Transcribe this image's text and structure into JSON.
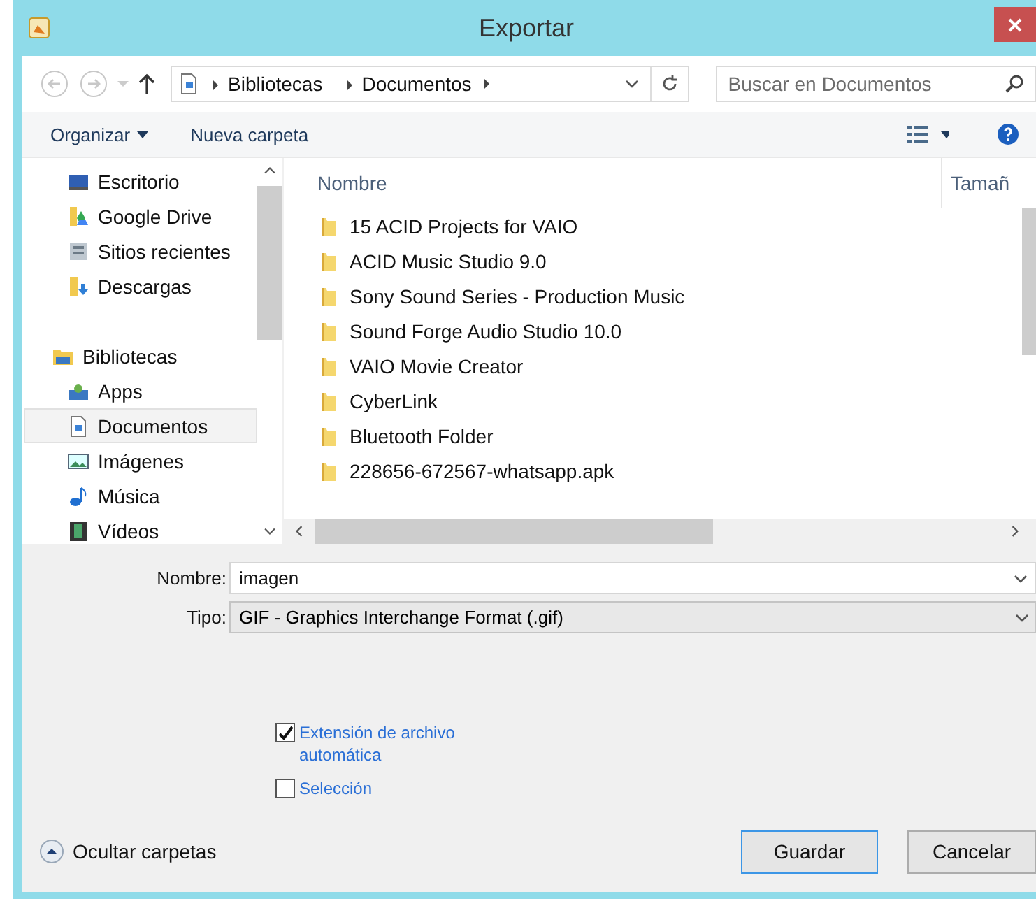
{
  "window": {
    "title": "Exportar"
  },
  "address": {
    "crumbs": [
      "Bibliotecas",
      "Documentos"
    ]
  },
  "search": {
    "placeholder": "Buscar en Documentos"
  },
  "toolbar": {
    "organize": "Organizar",
    "new_folder": "Nueva carpeta"
  },
  "sidebar": {
    "items": [
      {
        "label": "Escritorio",
        "kind": "desktop",
        "selected": false
      },
      {
        "label": "Google Drive",
        "kind": "drive",
        "selected": false
      },
      {
        "label": "Sitios recientes",
        "kind": "recent",
        "selected": false
      },
      {
        "label": "Descargas",
        "kind": "downloads",
        "selected": false
      }
    ],
    "libraries": {
      "label": "Bibliotecas",
      "selected": false,
      "children": [
        {
          "label": "Apps",
          "kind": "apps",
          "selected": false
        },
        {
          "label": "Documentos",
          "kind": "document",
          "selected": true
        },
        {
          "label": "Imágenes",
          "kind": "pictures",
          "selected": false
        },
        {
          "label": "Música",
          "kind": "music",
          "selected": false
        },
        {
          "label": "Vídeos",
          "kind": "videos",
          "selected": false
        }
      ]
    }
  },
  "file_list": {
    "columns": [
      "Nombre",
      "Tamañ"
    ],
    "rows": [
      "15 ACID Projects for VAIO",
      "ACID Music Studio 9.0",
      "Sony Sound Series - Production Music",
      "Sound Forge Audio Studio 10.0",
      "VAIO Movie Creator",
      "CyberLink",
      "Bluetooth Folder",
      "228656-672567-whatsapp.apk"
    ]
  },
  "form": {
    "name_label": "Nombre:",
    "name_value": "imagen",
    "type_label": "Tipo:",
    "type_value": "GIF - Graphics Interchange Format (.gif)"
  },
  "options": [
    {
      "label": "Extensión de archivo automática",
      "checked": true
    },
    {
      "label": "Selección",
      "checked": false
    }
  ],
  "footer": {
    "toggle": "Ocultar carpetas",
    "buttons": [
      {
        "label": "Guardar",
        "default": true
      },
      {
        "label": "Cancelar",
        "default": false
      }
    ]
  }
}
